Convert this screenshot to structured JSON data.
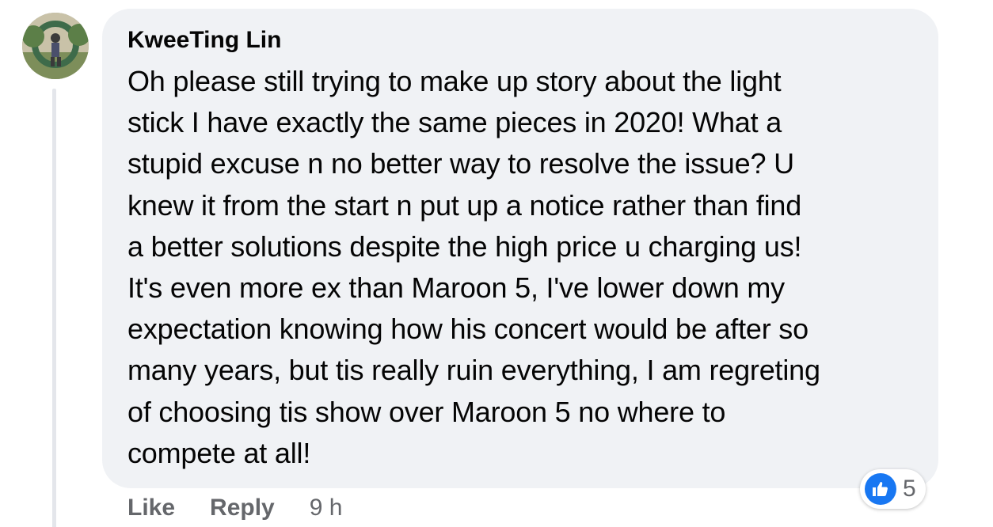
{
  "comment": {
    "author": "KweeTing Lin",
    "text_lines": [
      "Oh please still trying to make up story about the light",
      "stick I have exactly the same pieces in 2020! What a",
      "stupid excuse n no better way to resolve the issue? U",
      "knew it from the start n put up a notice rather than find",
      "a better solutions despite the high price u charging us!",
      "It's even more ex than Maroon 5, I've lower down my",
      "expectation knowing how his concert would be after so",
      "many years, but tis really ruin everything, I am regreting",
      "of choosing tis show over Maroon 5 no where to",
      "compete at all!"
    ],
    "reactions": {
      "icon": "thumbs-up-icon",
      "count": "5",
      "color": "#1877f2"
    },
    "actions": {
      "like_label": "Like",
      "reply_label": "Reply",
      "timestamp": "9 h"
    }
  },
  "colors": {
    "bubble_bg": "#f0f2f5",
    "text": "#050505",
    "secondary_text": "#65676b",
    "thread_line": "#e4e6eb"
  }
}
